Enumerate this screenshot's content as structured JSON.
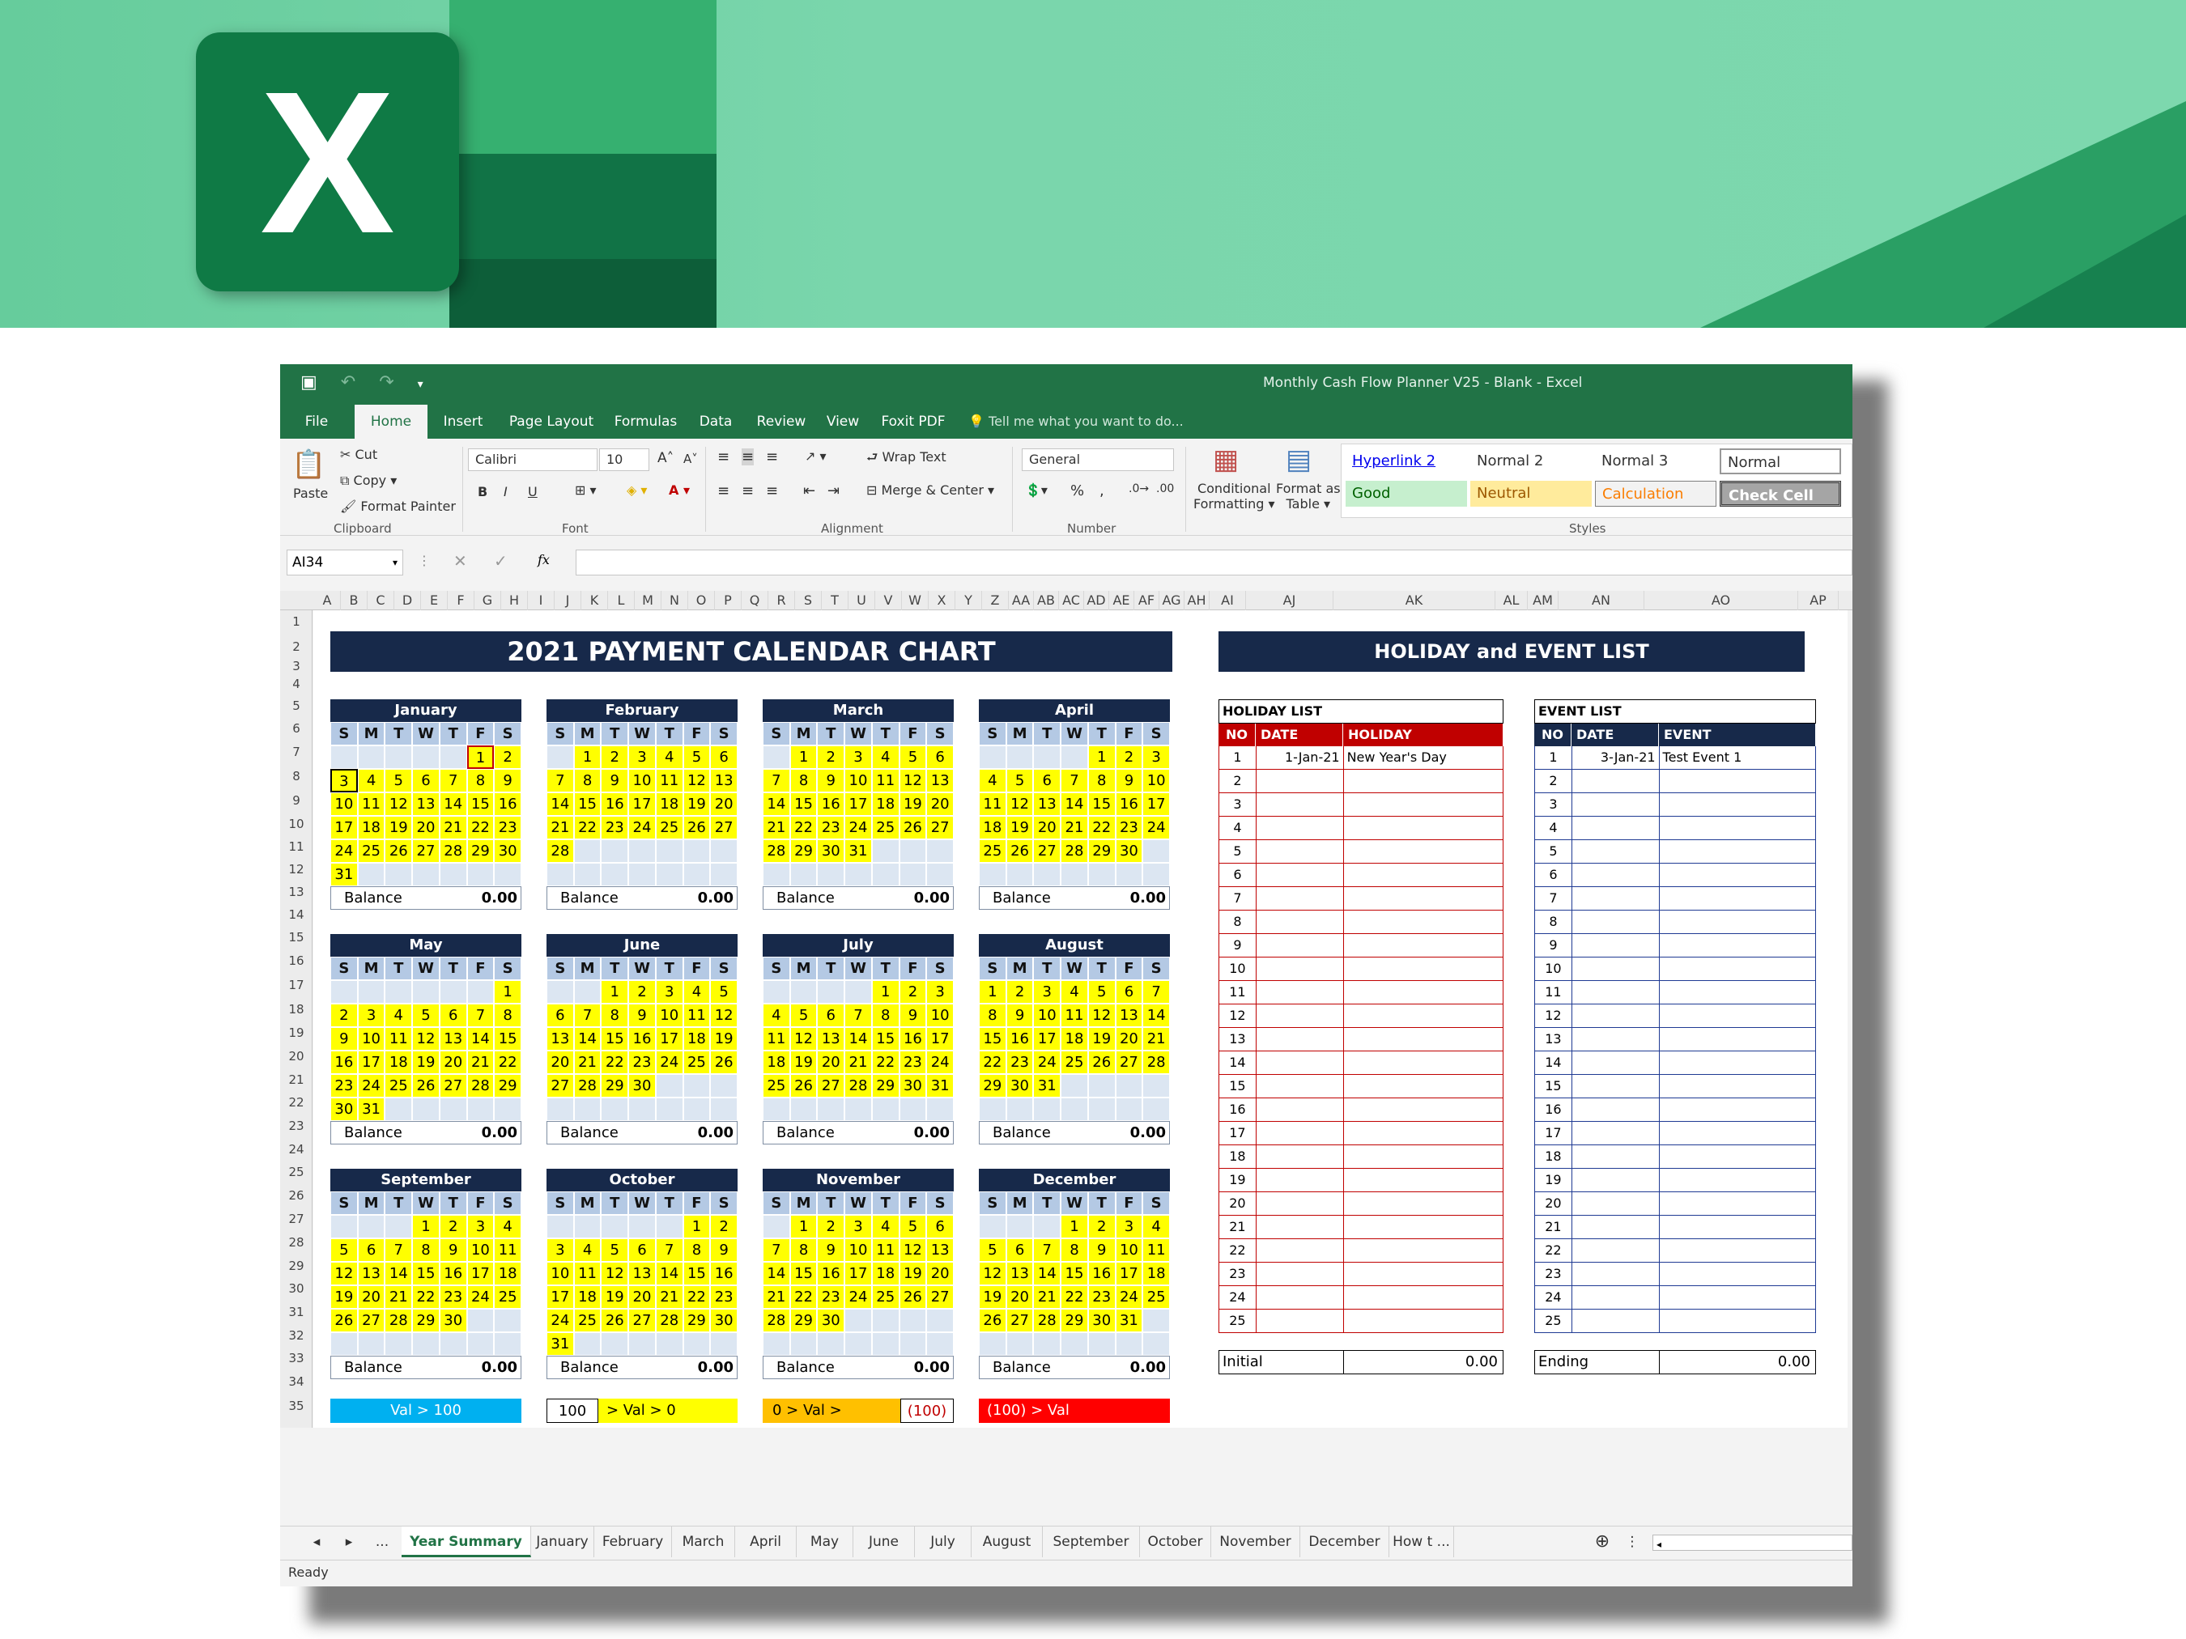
{
  "window": {
    "title": "Monthly Cash Flow Planner V25 - Blank - Excel"
  },
  "menu_tabs": [
    "File",
    "Home",
    "Insert",
    "Page Layout",
    "Formulas",
    "Data",
    "Review",
    "View",
    "Foxit PDF"
  ],
  "tell_me": "Tell me what you want to do...",
  "ribbon": {
    "clipboard": {
      "paste": "Paste",
      "cut": "Cut",
      "copy": "Copy",
      "format_painter": "Format Painter",
      "label": "Clipboard"
    },
    "font": {
      "name": "Calibri",
      "size": "10",
      "label": "Font",
      "bold": "B",
      "italic": "I",
      "underline": "U"
    },
    "alignment": {
      "wrap": "Wrap Text",
      "merge": "Merge & Center",
      "label": "Alignment"
    },
    "number": {
      "format": "General",
      "label": "Number",
      "percent": "%",
      "comma": ","
    },
    "cond": {
      "line1": "Conditional",
      "line2": "Formatting"
    },
    "fmt_table": {
      "line1": "Format as",
      "line2": "Table"
    },
    "styles": {
      "label": "Styles",
      "hyperlink2": "Hyperlink 2",
      "normal2": "Normal 2",
      "normal3": "Normal 3",
      "normal": "Normal",
      "good": "Good",
      "neutral": "Neutral",
      "calculation": "Calculation",
      "check_cell": "Check Cell"
    }
  },
  "name_box": "AI34",
  "fx": "fx",
  "columns": [
    "A",
    "B",
    "C",
    "D",
    "E",
    "F",
    "G",
    "H",
    "I",
    "J",
    "K",
    "L",
    "M",
    "N",
    "O",
    "P",
    "Q",
    "R",
    "S",
    "T",
    "U",
    "V",
    "W",
    "X",
    "Y",
    "Z",
    "AA",
    "AB",
    "AC",
    "AD",
    "AE",
    "AF",
    "AG",
    "AH",
    "AI",
    "AJ",
    "AK",
    "AL",
    "AM",
    "AN",
    "AO",
    "AP"
  ],
  "rows": [
    "1",
    "2",
    "3",
    "4",
    "5",
    "6",
    "7",
    "8",
    "9",
    "10",
    "11",
    "12",
    "13",
    "14",
    "15",
    "16",
    "17",
    "18",
    "19",
    "20",
    "21",
    "22",
    "23",
    "24",
    "25",
    "26",
    "27",
    "28",
    "29",
    "30",
    "31",
    "32",
    "33",
    "34",
    "35"
  ],
  "title": "2021 PAYMENT CALENDAR CHART",
  "right_title": "HOLIDAY and EVENT LIST",
  "weekdays": [
    "S",
    "M",
    "T",
    "W",
    "T",
    "F",
    "S"
  ],
  "months": [
    {
      "name": "January",
      "start": 5,
      "days": 31
    },
    {
      "name": "February",
      "start": 1,
      "days": 28
    },
    {
      "name": "March",
      "start": 1,
      "days": 31
    },
    {
      "name": "April",
      "start": 4,
      "days": 30
    },
    {
      "name": "May",
      "start": 6,
      "days": 31
    },
    {
      "name": "June",
      "start": 2,
      "days": 30
    },
    {
      "name": "July",
      "start": 4,
      "days": 31
    },
    {
      "name": "August",
      "start": 0,
      "days": 31
    },
    {
      "name": "September",
      "start": 3,
      "days": 30
    },
    {
      "name": "October",
      "start": 5,
      "days": 31
    },
    {
      "name": "November",
      "start": 1,
      "days": 30
    },
    {
      "name": "December",
      "start": 3,
      "days": 31
    }
  ],
  "balance_label": "Balance",
  "balance_value": "0.00",
  "legend": [
    {
      "text": "Val     >     100"
    },
    {
      "left": "100",
      "text": "> Val     >   0"
    },
    {
      "text": "0   >  Val      >",
      "right": "(100)"
    },
    {
      "text": "(100)   >  Val"
    }
  ],
  "holiday_list": {
    "title": "HOLIDAY LIST",
    "headers": [
      "NO",
      "DATE",
      "HOLIDAY"
    ],
    "rows": [
      [
        "1",
        "1-Jan-21",
        "New Year's Day"
      ]
    ],
    "count": 25,
    "summary_label": "Initial",
    "summary_value": "0.00"
  },
  "event_list": {
    "title": "EVENT LIST",
    "headers": [
      "NO",
      "DATE",
      "EVENT"
    ],
    "rows": [
      [
        "1",
        "3-Jan-21",
        "Test Event 1"
      ]
    ],
    "count": 25,
    "summary_label": "Ending",
    "summary_value": "0.00"
  },
  "sheet_tabs": [
    "Year Summary",
    "January",
    "February",
    "March",
    "April",
    "May",
    "June",
    "July",
    "August",
    "September",
    "October",
    "November",
    "December",
    "How t ..."
  ],
  "tab_nav": {
    "prev": "◂",
    "next": "▸",
    "more": "..."
  },
  "status": "Ready",
  "colors": {
    "excel_green": "#217346",
    "navy": "#17294a",
    "yellow": "#ffff00",
    "red": "#c00000",
    "blue": "#1f3a93"
  }
}
